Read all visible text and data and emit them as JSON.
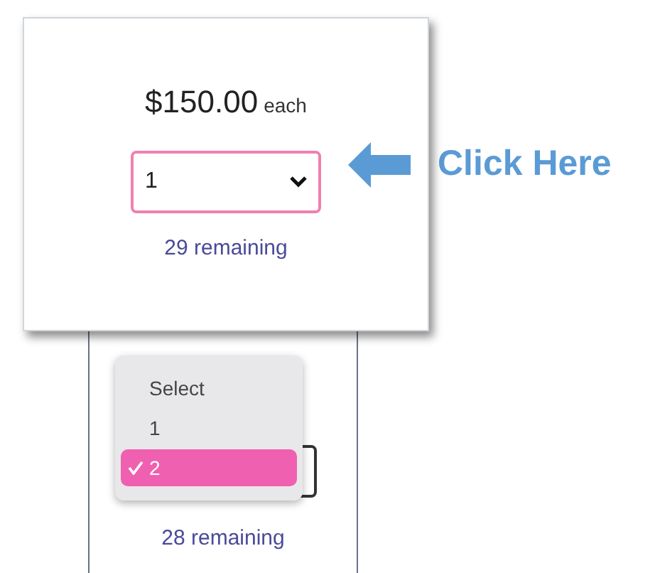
{
  "card": {
    "price": "$150.00",
    "unit": "each",
    "quantity_select": {
      "value": "1",
      "focused": true
    },
    "remaining": "29 remaining"
  },
  "callout": {
    "label": "Click Here"
  },
  "lower_panel": {
    "dropdown": {
      "options": [
        {
          "label": "Select",
          "selected": false
        },
        {
          "label": "1",
          "selected": false
        },
        {
          "label": "2",
          "selected": true
        }
      ]
    },
    "remaining": "28 remaining"
  }
}
